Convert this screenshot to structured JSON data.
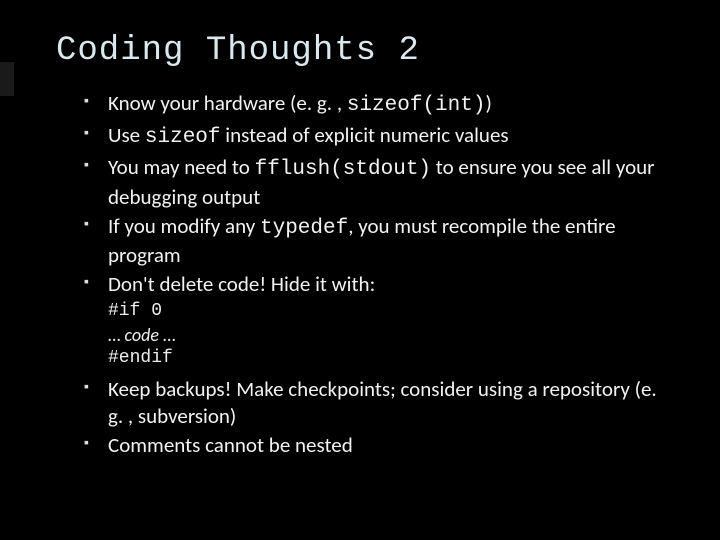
{
  "title": "Coding Thoughts 2",
  "bullets": {
    "b0": {
      "p0": "Know your hardware (e. g. , ",
      "c0": "sizeof(int)",
      "p1": ")"
    },
    "b1": {
      "p0": "Use ",
      "c0": "sizeof",
      "p1": " instead of explicit numeric values"
    },
    "b2": {
      "p0": "You may need to ",
      "c0": "fflush(stdout)",
      "p1": " to ensure you see all your debugging output"
    },
    "b3": {
      "p0": "If you modify any ",
      "c0": "typedef",
      "p1": ", you must recompile the entire program"
    },
    "b4": {
      "p0": "Don't delete code! Hide it with:"
    },
    "b5": {
      "p0": "Keep backups! Make checkpoints; consider using a repository (e. g. , subversion)"
    },
    "b6": {
      "p0": "Comments cannot be nested"
    }
  },
  "codeblock": {
    "l0": "#if 0",
    "l1_pre": "… ",
    "l1_ital": "code",
    "l1_post": " …",
    "l2": "#endif"
  }
}
